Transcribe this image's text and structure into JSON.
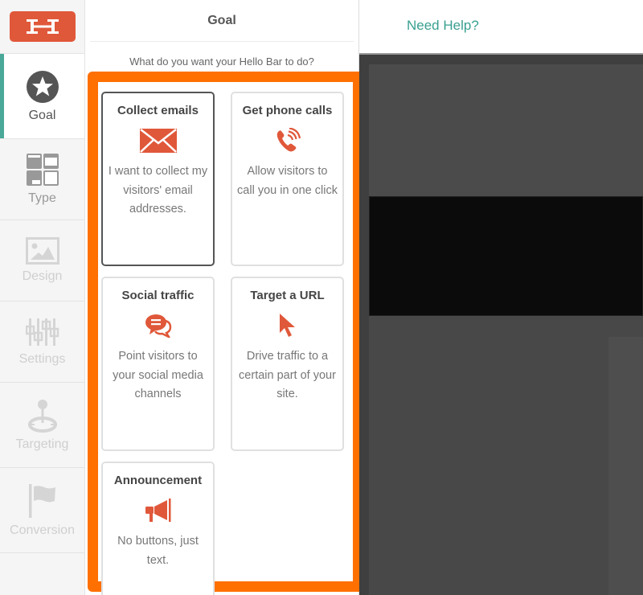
{
  "sidebar": {
    "logo": "hello-bar-logo",
    "items": [
      {
        "label": "Goal",
        "icon": "star-icon",
        "state": "active"
      },
      {
        "label": "Type",
        "icon": "layout-grid-icon",
        "state": "enabled"
      },
      {
        "label": "Design",
        "icon": "image-icon",
        "state": "disabled"
      },
      {
        "label": "Settings",
        "icon": "sliders-icon",
        "state": "disabled"
      },
      {
        "label": "Targeting",
        "icon": "target-pin-icon",
        "state": "disabled"
      },
      {
        "label": "Conversion",
        "icon": "flag-icon",
        "state": "disabled"
      }
    ]
  },
  "goal_panel": {
    "title": "Goal",
    "subtitle": "What do you want your Hello Bar to do?",
    "highlight_color": "#ff7000",
    "icon_color": "#e0583a",
    "options": [
      {
        "title": "Collect emails",
        "icon": "envelope-icon",
        "description": "I want to collect my visitors' email addresses.",
        "selected": true
      },
      {
        "title": "Get phone calls",
        "icon": "phone-icon",
        "description": "Allow visitors to call you in one click",
        "selected": false
      },
      {
        "title": "Social traffic",
        "icon": "chat-bubbles-icon",
        "description": "Point visitors to your social media channels",
        "selected": false
      },
      {
        "title": "Target a URL",
        "icon": "cursor-arrow-icon",
        "description": "Drive traffic to a certain part of your site.",
        "selected": false
      },
      {
        "title": "Announcement",
        "icon": "megaphone-icon",
        "description": "No buttons, just text.",
        "selected": false
      }
    ]
  },
  "topbar": {
    "help_link": "Need Help?",
    "help_color": "#3aa090"
  }
}
